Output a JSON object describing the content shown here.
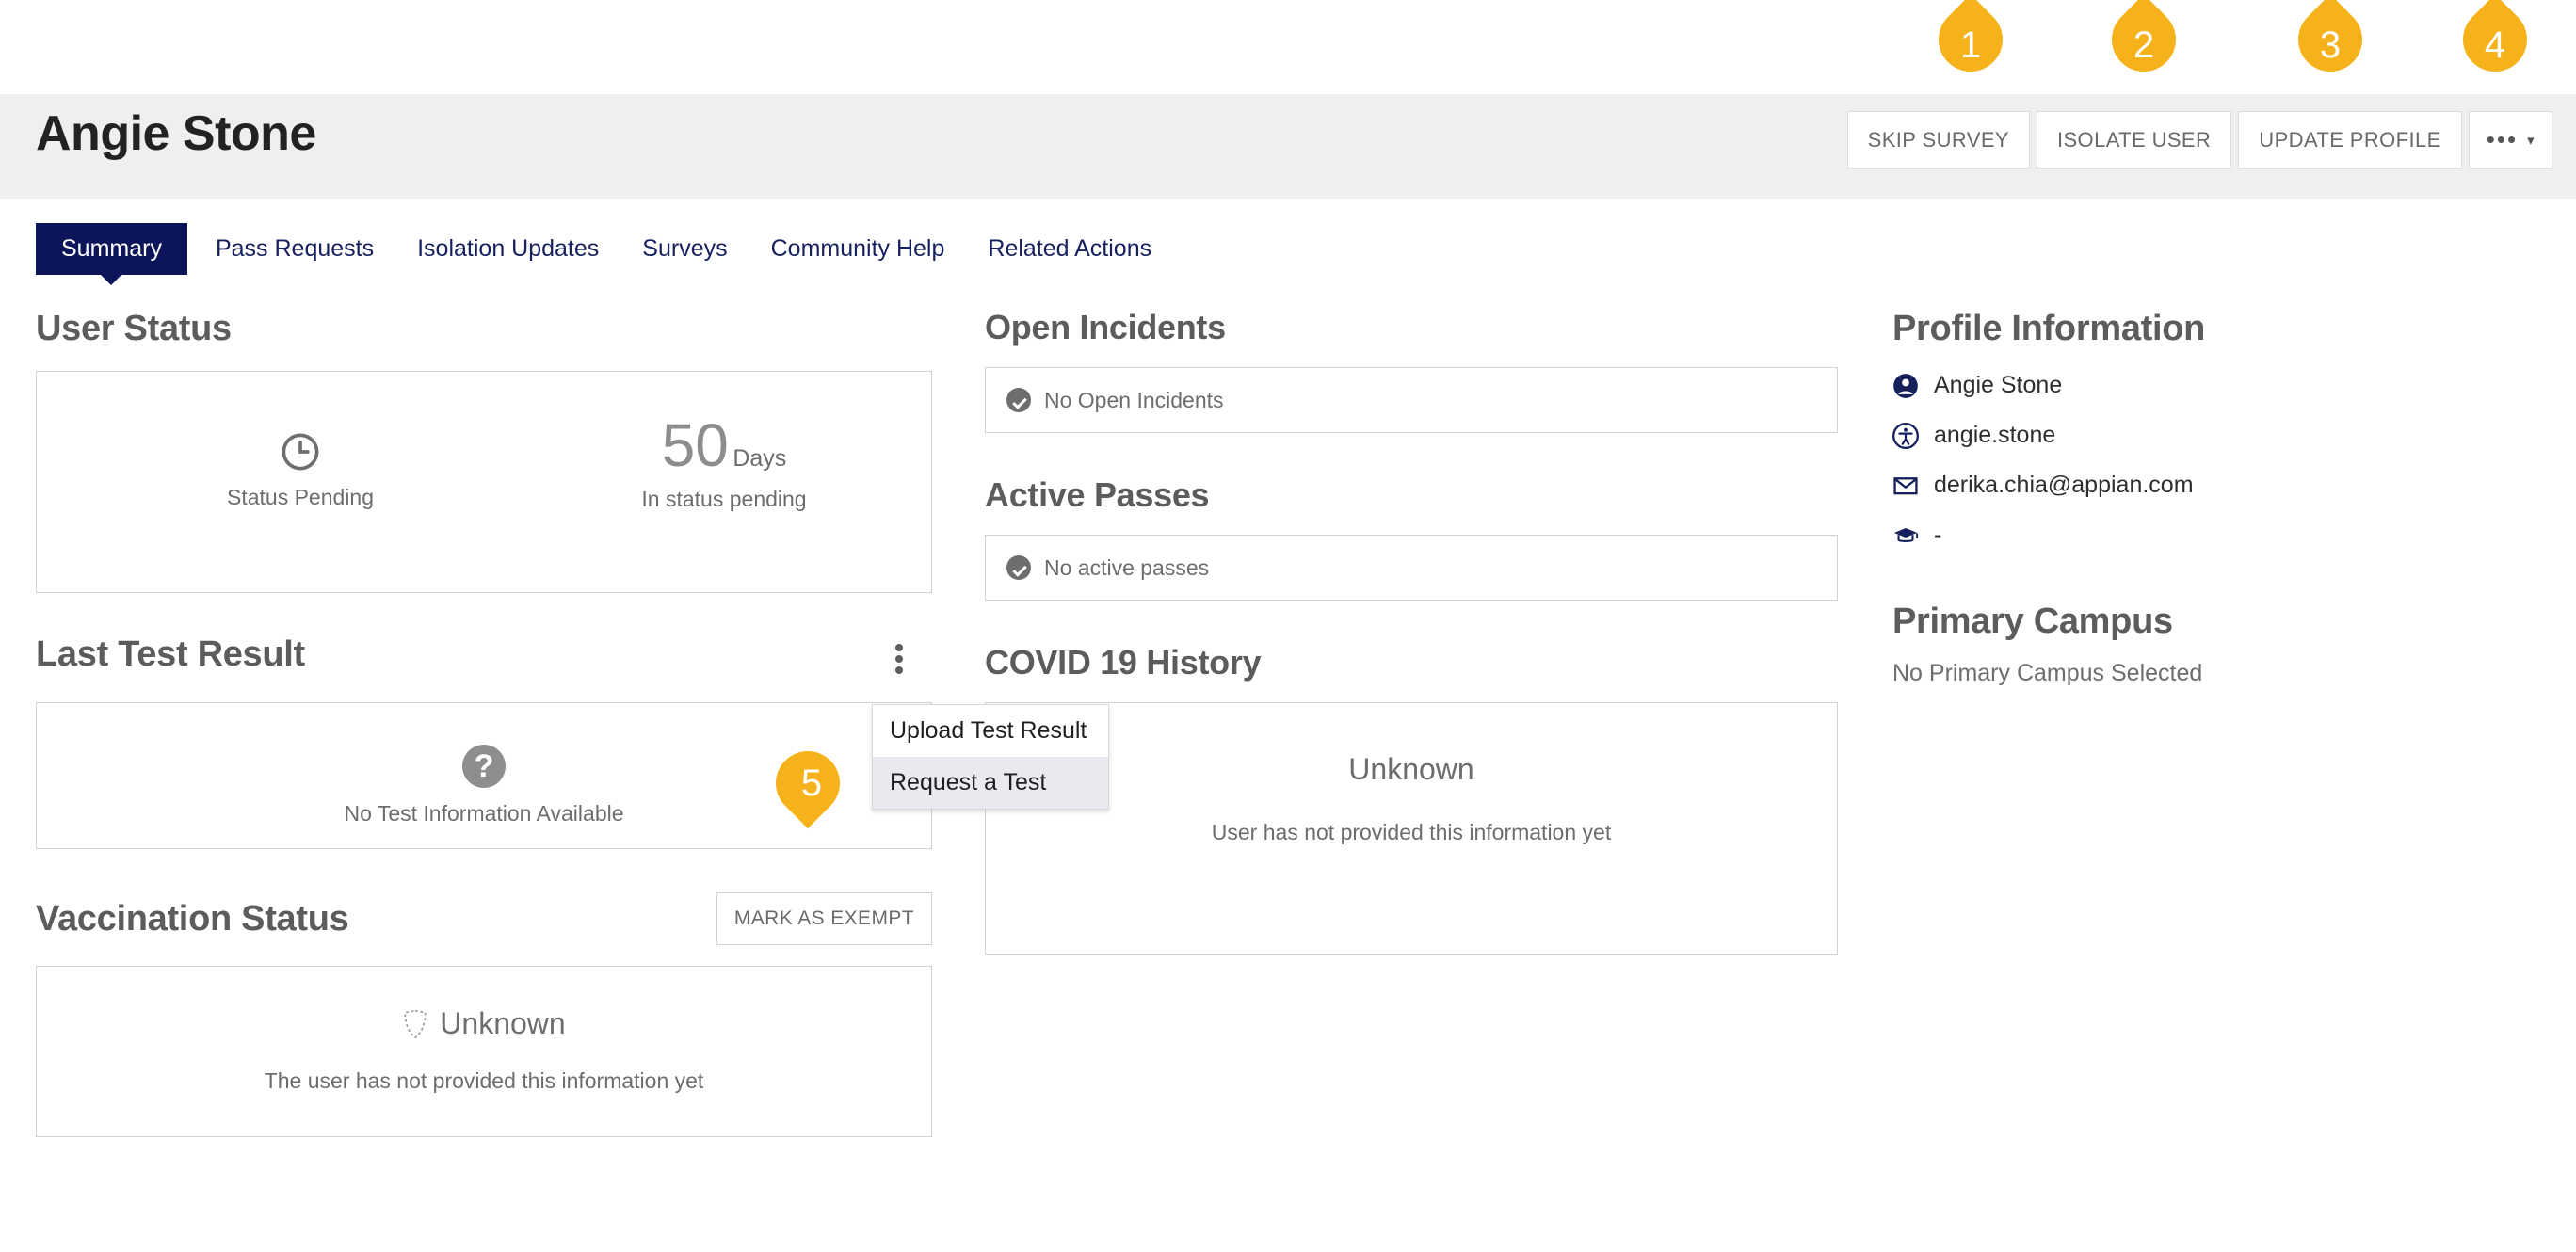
{
  "header": {
    "title": "Angie Stone",
    "actions": [
      {
        "label": "SKIP SURVEY",
        "name": "skip-survey-button"
      },
      {
        "label": "ISOLATE USER",
        "name": "isolate-user-button"
      },
      {
        "label": "UPDATE PROFILE",
        "name": "update-profile-button"
      }
    ],
    "more_menu": {
      "dots": "•••",
      "caret": "▾"
    }
  },
  "tabs": [
    {
      "label": "Summary",
      "active": true
    },
    {
      "label": "Pass Requests",
      "active": false
    },
    {
      "label": "Isolation Updates",
      "active": false
    },
    {
      "label": "Surveys",
      "active": false
    },
    {
      "label": "Community Help",
      "active": false
    },
    {
      "label": "Related Actions",
      "active": false
    }
  ],
  "user_status": {
    "heading": "User Status",
    "status_label": "Status Pending",
    "days_value": "50",
    "days_unit": "Days",
    "days_caption": "In status pending"
  },
  "last_test_result": {
    "heading": "Last Test Result",
    "empty_text": "No Test Information Available",
    "question_glyph": "?"
  },
  "vaccination": {
    "heading": "Vaccination Status",
    "action_label": "MARK AS EXEMPT",
    "status": "Unknown",
    "subtext": "The user has not provided this information yet"
  },
  "open_incidents": {
    "heading": "Open Incidents",
    "empty_text": "No Open Incidents"
  },
  "active_passes": {
    "heading": "Active Passes",
    "empty_text": "No active passes"
  },
  "covid_history": {
    "heading": "COVID 19 History",
    "status": "Unknown",
    "subtext": "User has not provided this information yet"
  },
  "profile": {
    "heading": "Profile Information",
    "rows": [
      {
        "icon": "person-circle-icon",
        "text": "Angie Stone"
      },
      {
        "icon": "accessibility-circle-icon",
        "text": "angie.stone"
      },
      {
        "icon": "envelope-icon",
        "text": "derika.chia@appian.com"
      },
      {
        "icon": "graduation-cap-icon",
        "text": "-"
      }
    ]
  },
  "primary_campus": {
    "heading": "Primary Campus",
    "text": "No Primary Campus Selected"
  },
  "context_menu": {
    "items": [
      {
        "label": "Upload Test Result",
        "hovered": false
      },
      {
        "label": "Request a Test",
        "hovered": true
      }
    ]
  },
  "annotations": [
    {
      "number": "1"
    },
    {
      "number": "2"
    },
    {
      "number": "3"
    },
    {
      "number": "4"
    },
    {
      "number": "5"
    }
  ],
  "colors": {
    "accent_navy": "#0c1559",
    "annotation_amber": "#f5b21a",
    "header_band": "#efefef",
    "icon_navy": "#16205c",
    "muted_text": "#6d6d6d"
  }
}
